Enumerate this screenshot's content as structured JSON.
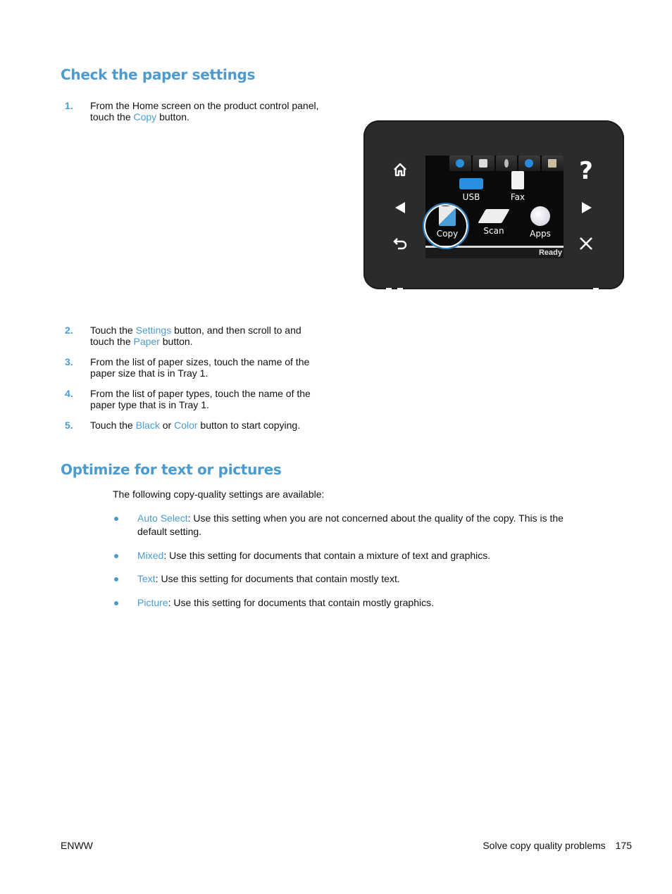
{
  "section1": {
    "title": "Check the paper settings",
    "steps": [
      {
        "num": "1.",
        "parts": [
          {
            "text": "From the Home screen on the product control panel, touch the ",
            "link": false
          },
          {
            "text": "Copy",
            "link": true
          },
          {
            "text": " button.",
            "link": false
          }
        ]
      },
      {
        "num": "2.",
        "parts": [
          {
            "text": "Touch the ",
            "link": false
          },
          {
            "text": "Settings",
            "link": true
          },
          {
            "text": " button, and then scroll to and touch the ",
            "link": false
          },
          {
            "text": "Paper",
            "link": true
          },
          {
            "text": " button.",
            "link": false
          }
        ]
      },
      {
        "num": "3.",
        "parts": [
          {
            "text": "From the list of paper sizes, touch the name of the paper size that is in Tray 1.",
            "link": false
          }
        ]
      },
      {
        "num": "4.",
        "parts": [
          {
            "text": "From the list of paper types, touch the name of the paper type that is in Tray 1.",
            "link": false
          }
        ]
      },
      {
        "num": "5.",
        "parts": [
          {
            "text": "Touch the ",
            "link": false
          },
          {
            "text": "Black",
            "link": true
          },
          {
            "text": " or ",
            "link": false
          },
          {
            "text": "Color",
            "link": true
          },
          {
            "text": " button to start copying.",
            "link": false
          }
        ]
      }
    ]
  },
  "control_panel": {
    "left_buttons": [
      "home-icon",
      "left-arrow-icon",
      "back-icon"
    ],
    "right_buttons": [
      "help-icon",
      "right-arrow-icon",
      "cancel-icon"
    ],
    "left_glyphs": [
      "⌂",
      "◀",
      "↶"
    ],
    "right_glyphs": [
      "?",
      "▶",
      "✕"
    ],
    "top_icons": [
      "web-services-icon",
      "setup-icon",
      "wireless-icon",
      "eprint-icon",
      "supplies-icon"
    ],
    "apps": [
      {
        "label": "USB",
        "icon": "usb-icon"
      },
      {
        "label": "Fax",
        "icon": "fax-icon"
      },
      {
        "label": "Copy",
        "icon": "copy-icon"
      },
      {
        "label": "Scan",
        "icon": "scan-icon"
      },
      {
        "label": "Apps",
        "icon": "apps-icon"
      }
    ],
    "status": "Ready",
    "accent": "#2f7fc1"
  },
  "section2": {
    "title": "Optimize for text or pictures",
    "intro": "The following copy-quality settings are available:",
    "bullets": [
      {
        "term": "Auto Select",
        "desc": ": Use this setting when you are not concerned about the quality of the copy. This is the default setting."
      },
      {
        "term": "Mixed",
        "desc": ": Use this setting for documents that contain a mixture of text and graphics."
      },
      {
        "term": "Text",
        "desc": ": Use this setting for documents that contain mostly text."
      },
      {
        "term": "Picture",
        "desc": ": Use this setting for documents that contain mostly graphics."
      }
    ]
  },
  "footer": {
    "left": "ENWW",
    "section": "Solve copy quality problems",
    "page": "175"
  },
  "colors": {
    "accent": "#4b9bd0",
    "text": "#111111"
  }
}
